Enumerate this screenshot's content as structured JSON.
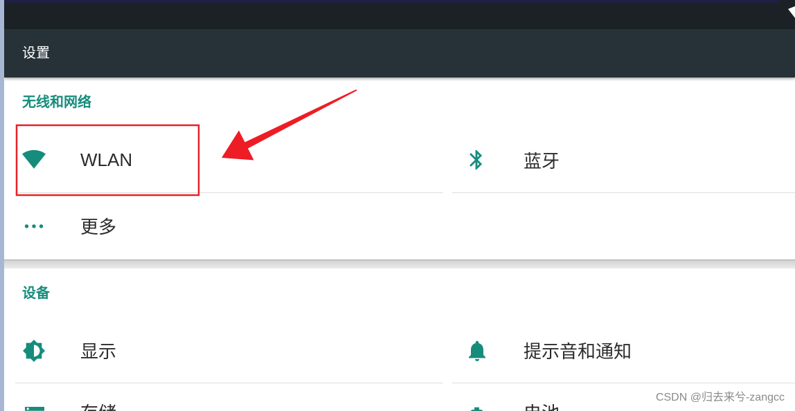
{
  "status_bar": {
    "signal_icon": "wifi-signal-icon"
  },
  "action_bar": {
    "title": "设置"
  },
  "sections": [
    {
      "header": "无线和网络",
      "items": [
        {
          "label": "WLAN",
          "icon": "wifi-icon"
        },
        {
          "label": "蓝牙",
          "icon": "bluetooth-icon"
        },
        {
          "label": "更多",
          "icon": "more-dots-icon"
        }
      ]
    },
    {
      "header": "设备",
      "items": [
        {
          "label": "显示",
          "icon": "brightness-icon"
        },
        {
          "label": "提示音和通知",
          "icon": "bell-icon"
        },
        {
          "label": "存储",
          "icon": "storage-icon"
        },
        {
          "label": "电池",
          "icon": "battery-icon"
        }
      ]
    }
  ],
  "watermark": "CSDN @归去来兮-zangcc",
  "colors": {
    "accent": "#168c7c",
    "status_bar": "#1b2125",
    "action_bar": "#263238",
    "divider": "#dedede",
    "annotation_red": "#e62129"
  }
}
